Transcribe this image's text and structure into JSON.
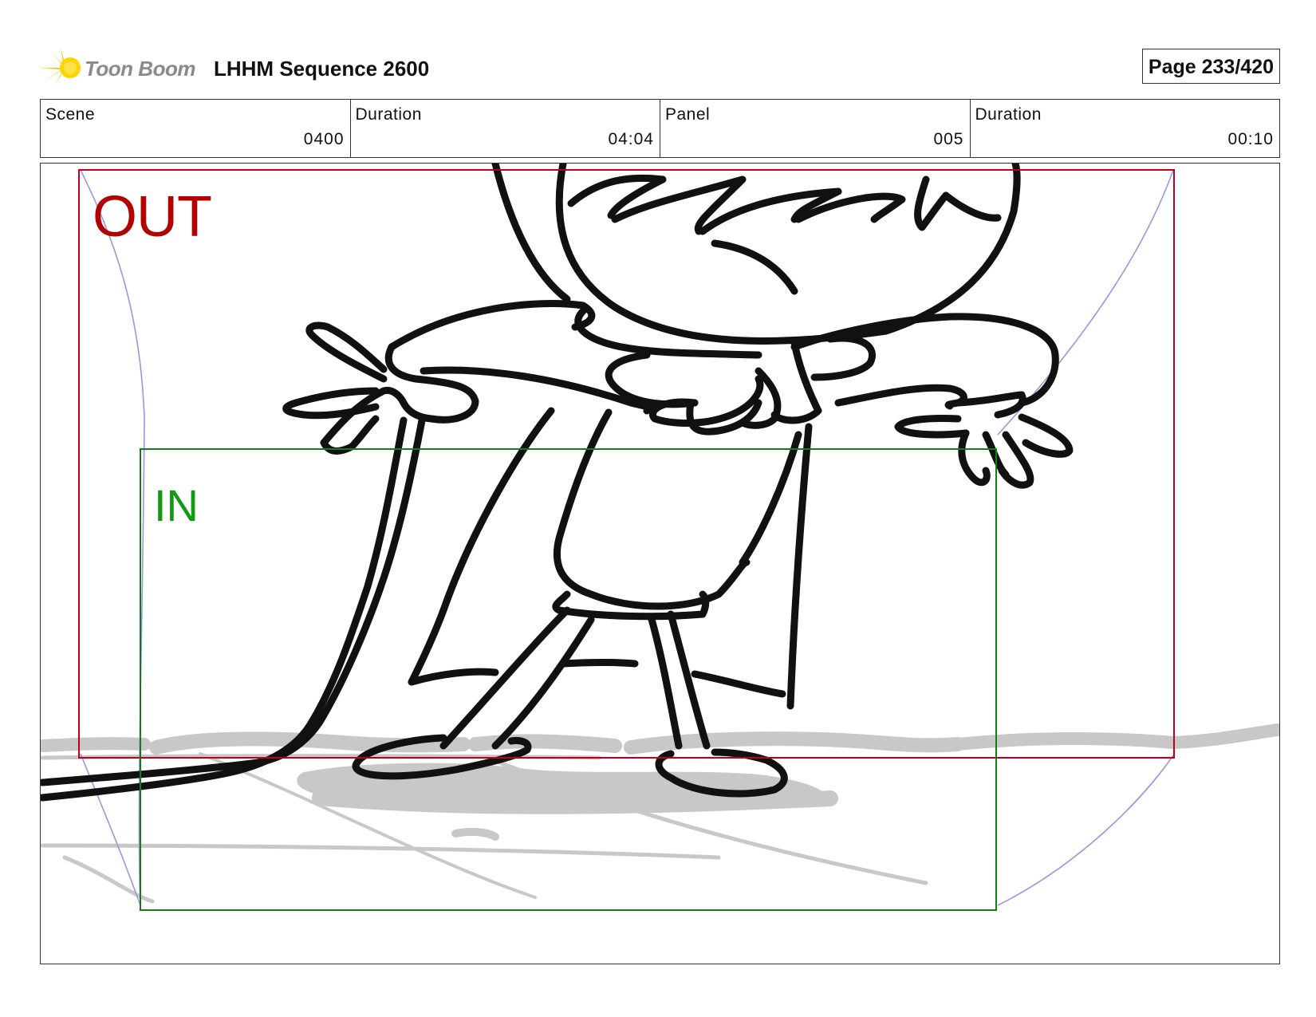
{
  "header": {
    "logo_text": "Toon Boom",
    "sequence_title": "LHHM Sequence 2600",
    "page_indicator": "Page 233/420"
  },
  "info": {
    "scene_label": "Scene",
    "scene_value": "0400",
    "scene_duration_label": "Duration",
    "scene_duration_value": "04:04",
    "panel_label": "Panel",
    "panel_value": "005",
    "panel_duration_label": "Duration",
    "panel_duration_value": "00:10"
  },
  "panel": {
    "out_label": "OUT",
    "in_label": "IN"
  },
  "colors": {
    "out_frame": "#c0001a",
    "in_frame": "#1a7a1a",
    "guide_arcs": "#9a96e0",
    "sketch_ink": "#111111",
    "ground_shading": "#c8c8c8",
    "logo_burst": "#f7c800"
  }
}
